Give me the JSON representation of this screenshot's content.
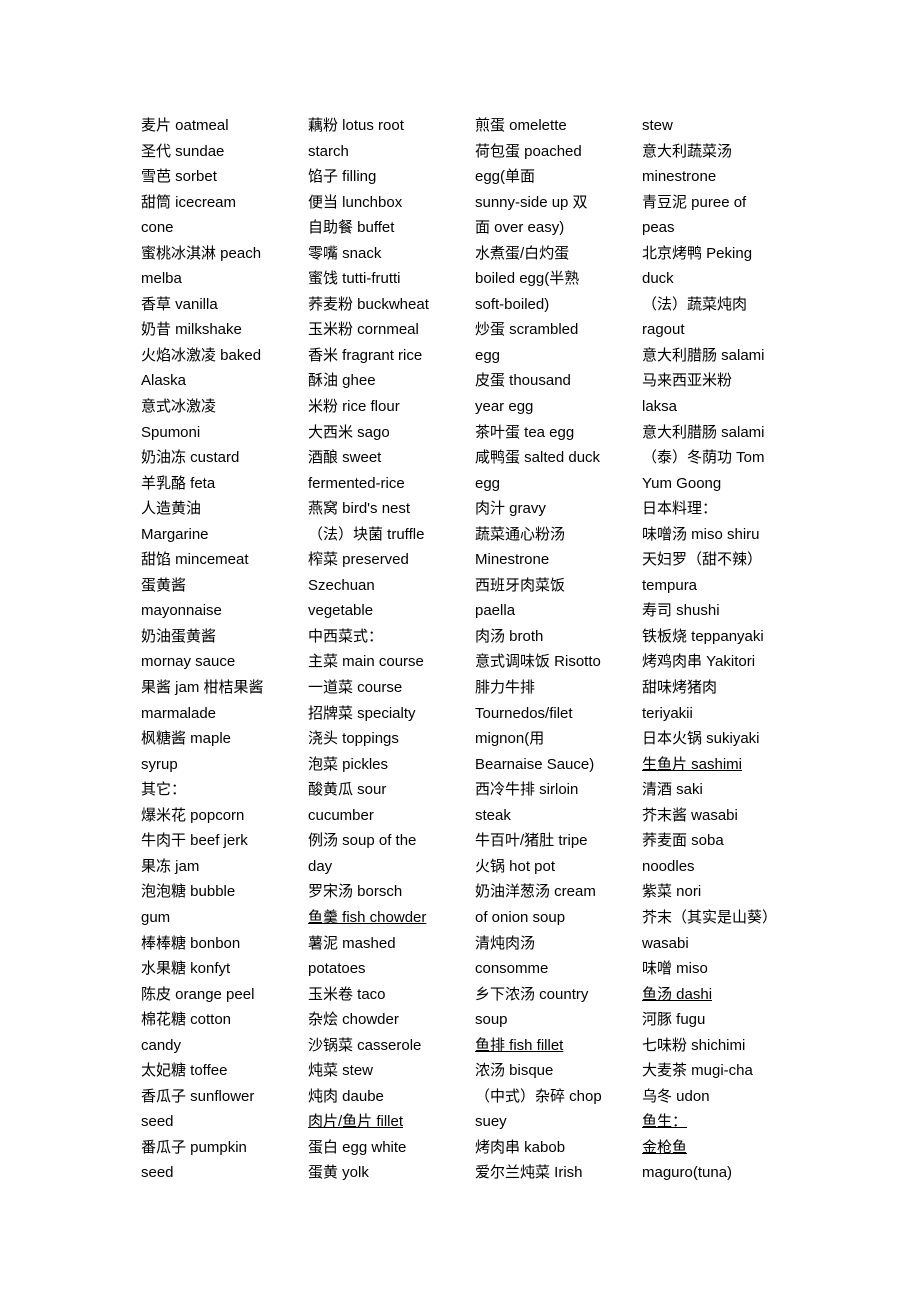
{
  "document": {
    "type": "glossary-list",
    "title": "",
    "layout": "four-column-list",
    "column_count": 4,
    "row_count": 42,
    "columns": [
      {
        "index": 1,
        "name": "column-1",
        "entries": [
          "麦片 oatmeal",
          "圣代 sundae",
          "雪芭 sorbet",
          "甜筒 icecream",
          "cone",
          "蜜桃冰淇淋 peach",
          "melba",
          "香草 vanilla",
          "奶昔 milkshake",
          "火焰冰激凌 baked",
          "Alaska",
          "意式冰激凌",
          "Spumoni",
          "奶油冻 custard",
          "羊乳酪 feta",
          "人造黄油",
          "Margarine",
          "甜馅 mincemeat",
          "蛋黄酱",
          "mayonnaise",
          "奶油蛋黄酱",
          "mornay sauce",
          "果酱 jam 柑桔果酱",
          "marmalade",
          "枫糖酱 maple",
          "syrup",
          "其它：",
          "爆米花 popcorn",
          "牛肉干 beef jerk",
          "果冻 jam",
          "泡泡糖 bubble",
          "gum",
          "棒棒糖 bonbon",
          "水果糖 konfyt",
          "陈皮 orange peel",
          "棉花糖 cotton",
          "candy",
          "太妃糖 toffee",
          "香瓜子 sunflower",
          "seed",
          "番瓜子 pumpkin",
          "seed"
        ]
      },
      {
        "index": 2,
        "name": "column-2",
        "entries": [
          "藕粉 lotus root",
          "starch",
          "馅子 filling",
          "便当 lunchbox",
          "自助餐 buffet",
          "零嘴 snack",
          "蜜饯 tutti-frutti",
          "荞麦粉 buckwheat",
          "玉米粉 cornmeal",
          "香米 fragrant rice",
          "酥油 ghee",
          "米粉 rice flour",
          "大西米 sago",
          "酒酿 sweet",
          "fermented-rice",
          "燕窝 bird's nest",
          "（法）块菌 truffle",
          "榨菜 preserved",
          "Szechuan",
          "vegetable",
          "中西菜式：",
          "主菜 main course",
          "一道菜 course",
          "招牌菜 specialty",
          "浇头 toppings",
          "泡菜 pickles",
          "酸黄瓜 sour",
          "cucumber",
          "例汤 soup of the",
          "day",
          "罗宋汤 borsch",
          "鱼羹 fish chowder",
          "薯泥 mashed",
          "potatoes",
          "玉米卷 taco",
          "杂烩 chowder",
          "沙锅菜 casserole",
          "炖菜 stew",
          "炖肉 daube",
          "肉片/鱼片 fillet",
          "蛋白 egg white",
          "蛋黄 yolk"
        ]
      },
      {
        "index": 3,
        "name": "column-3",
        "entries": [
          "煎蛋 omelette",
          "荷包蛋 poached",
          "egg(单面",
          "sunny-side up 双",
          "面 over easy)",
          "水煮蛋/白灼蛋",
          "boiled egg(半熟",
          "soft-boiled)",
          "炒蛋 scrambled",
          "egg",
          "皮蛋 thousand",
          "year egg",
          "茶叶蛋 tea egg",
          "咸鸭蛋 salted duck",
          "egg",
          "肉汁 gravy",
          "蔬菜通心粉汤",
          "Minestrone",
          "西班牙肉菜饭",
          "paella",
          "肉汤 broth",
          "意式调味饭 Risotto",
          "腓力牛排",
          "Tournedos/filet",
          "mignon(用",
          "Bearnaise Sauce)",
          "西冷牛排 sirloin",
          "steak",
          "牛百叶/猪肚 tripe",
          "火锅 hot pot",
          "奶油洋葱汤 cream",
          "of onion soup",
          "清炖肉汤",
          "consomme",
          "乡下浓汤 country",
          "soup",
          "鱼排 fish fillet",
          "浓汤 bisque",
          "（中式）杂碎 chop",
          "suey",
          "烤肉串 kabob",
          "爱尔兰炖菜 Irish"
        ]
      },
      {
        "index": 4,
        "name": "column-4",
        "entries": [
          "stew",
          "意大利蔬菜汤",
          "minestrone",
          "青豆泥 puree of",
          "peas",
          "北京烤鸭 Peking",
          "duck",
          "（法）蔬菜炖肉",
          "ragout",
          "意大利腊肠 salami",
          "马来西亚米粉",
          "laksa",
          "意大利腊肠 salami",
          "（泰）冬荫功 Tom",
          "Yum Goong",
          "日本料理：",
          "味噌汤 miso shiru",
          "天妇罗（甜不辣）",
          "tempura",
          "寿司 shushi",
          "铁板烧 teppanyaki",
          "烤鸡肉串 Yakitori",
          "甜味烤猪肉",
          "teriyakii",
          "日本火锅 sukiyaki",
          "生鱼片 sashimi",
          "清酒 saki",
          "芥末酱 wasabi",
          "荞麦面 soba",
          "noodles",
          "紫菜 nori",
          "芥末（其实是山葵）",
          "wasabi",
          "味噌 miso",
          "鱼汤 dashi",
          "河豚 fugu",
          "七味粉 shichimi",
          "大麦茶 mugi-cha",
          "乌冬 udon",
          "鱼生：",
          "金枪鱼",
          "maguro(tuna)"
        ]
      }
    ],
    "underlined_entries": [
      {
        "column": 2,
        "row": 32,
        "text": "鱼羹"
      },
      {
        "column": 2,
        "row": 40,
        "text": "鱼片"
      },
      {
        "column": 3,
        "row": 37,
        "text": "鱼排"
      },
      {
        "column": 4,
        "row": 26,
        "text": "生鱼片"
      },
      {
        "column": 4,
        "row": 35,
        "text": "鱼汤"
      },
      {
        "column": 4,
        "row": 40,
        "text": "鱼生"
      },
      {
        "column": 4,
        "row": 41,
        "text": "金枪鱼"
      }
    ],
    "colors": {
      "page_background": "#ffffff",
      "text": "#000000",
      "underline": "#000000"
    }
  }
}
